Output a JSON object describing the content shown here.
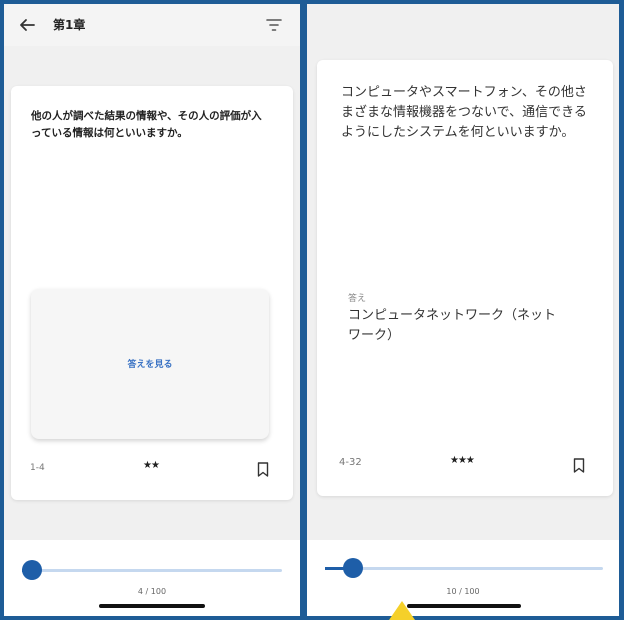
{
  "left_screen": {
    "header": {
      "title": "第1章"
    },
    "card": {
      "question": "他の人が調べた結果の情報や、その人の評価が入っている情報は何といいますか。",
      "reveal_button_label": "答えを見る",
      "card_number": "1-4",
      "stars": "★★"
    },
    "slider": {
      "counter": "4 / 100",
      "current": 4,
      "total": 100
    }
  },
  "right_screen": {
    "card": {
      "question": "コンピュータやスマートフォン、その他さまざまな情報機器をつないで、通信できるようにしたシステムを何といいますか。",
      "answer_caption": "答え",
      "answer": "コンピュータネットワーク（ネットワーク）",
      "card_number": "4-32",
      "stars": "★★★"
    },
    "slider": {
      "counter": "10 / 100",
      "current": 10,
      "total": 100
    }
  },
  "icons": {
    "back": "back-arrow-icon",
    "filter": "filter-icon",
    "bookmark": "bookmark-icon"
  },
  "colors": {
    "frame": "#1e5c96",
    "accent": "#1e5ea8",
    "reveal_text": "#3b73c4",
    "pointer": "#f5d02a"
  }
}
